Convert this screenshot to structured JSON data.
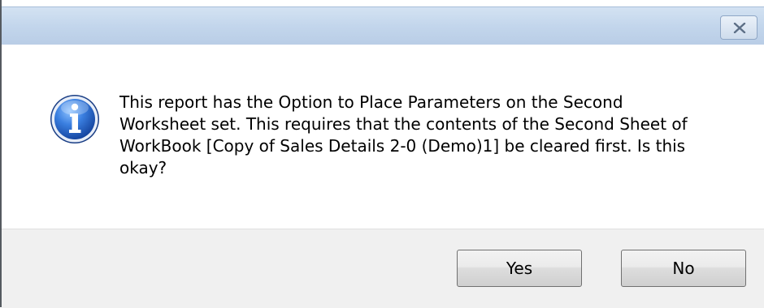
{
  "dialog": {
    "title": "",
    "message": "This report has the Option to Place Parameters on the Second\nWorksheet set. This requires that the contents of the Second Sheet of\nWorkBook [Copy of Sales Details 2-0 (Demo)1] be cleared first. Is this\nokay?",
    "icon": "info-icon"
  },
  "buttons": {
    "yes_label": "Yes",
    "no_label": "No"
  },
  "colors": {
    "titlebar": "#c3d6ec",
    "footer": "#f0f0f0",
    "info_icon_blue": "#1f5fbf"
  }
}
